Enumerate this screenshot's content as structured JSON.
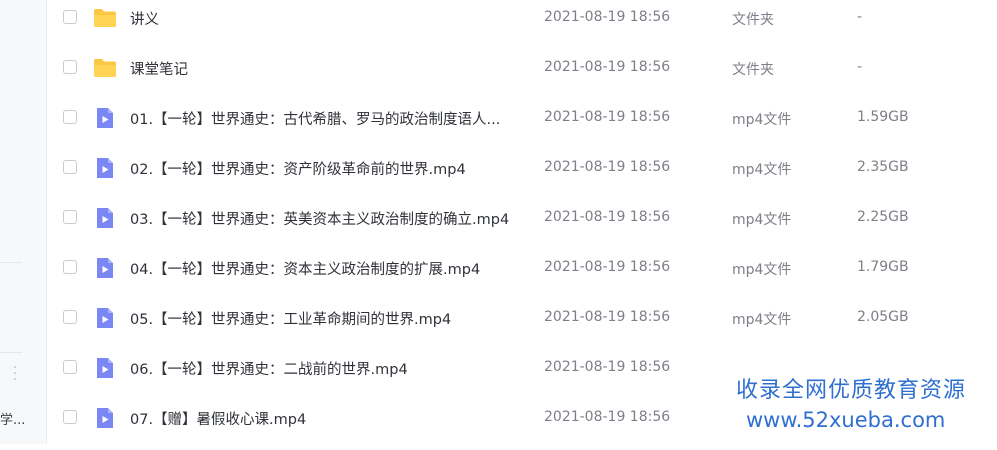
{
  "sidebar": {
    "truncated_text": "学..."
  },
  "files": [
    {
      "icon": "folder-icon",
      "name": "讲义",
      "date": "2021-08-19 18:56",
      "type": "文件夹",
      "size": "-"
    },
    {
      "icon": "folder-icon",
      "name": "课堂笔记",
      "date": "2021-08-19 18:56",
      "type": "文件夹",
      "size": "-"
    },
    {
      "icon": "video-file-icon",
      "name": "01.【一轮】世界通史：古代希腊、罗马的政治制度语人...",
      "date": "2021-08-19 18:56",
      "type": "mp4文件",
      "size": "1.59GB"
    },
    {
      "icon": "video-file-icon",
      "name": "02.【一轮】世界通史：资产阶级革命前的世界.mp4",
      "date": "2021-08-19 18:56",
      "type": "mp4文件",
      "size": "2.35GB"
    },
    {
      "icon": "video-file-icon",
      "name": "03.【一轮】世界通史：英美资本主义政治制度的确立.mp4",
      "date": "2021-08-19 18:56",
      "type": "mp4文件",
      "size": "2.25GB"
    },
    {
      "icon": "video-file-icon",
      "name": "04.【一轮】世界通史：资本主义政治制度的扩展.mp4",
      "date": "2021-08-19 18:56",
      "type": "mp4文件",
      "size": "1.79GB"
    },
    {
      "icon": "video-file-icon",
      "name": "05.【一轮】世界通史：工业革命期间的世界.mp4",
      "date": "2021-08-19 18:56",
      "type": "mp4文件",
      "size": "2.05GB"
    },
    {
      "icon": "video-file-icon",
      "name": "06.【一轮】世界通史：二战前的世界.mp4",
      "date": "2021-08-19 18:56",
      "type": "",
      "size": ""
    },
    {
      "icon": "video-file-icon",
      "name": "07.【赠】暑假收心课.mp4",
      "date": "2021-08-19 18:56",
      "type": "",
      "size": ""
    }
  ],
  "watermark": {
    "line1": "收录全网优质教育资源",
    "line2": "www.52xueba.com"
  },
  "colors": {
    "folder": "#fcc843",
    "video": "#7b87f4",
    "watermark": "#2f6fd0"
  }
}
